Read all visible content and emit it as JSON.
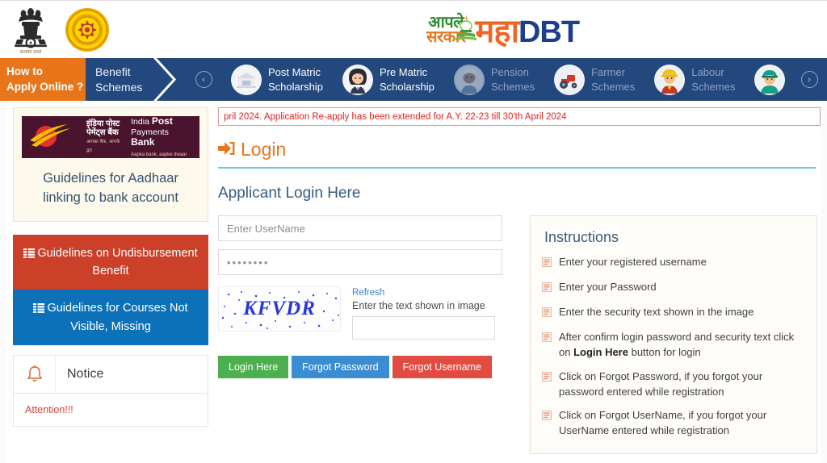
{
  "header": {
    "emblem_alt": "india-national-emblem",
    "emblem_caption": "सत्यमेव जयते",
    "seal_alt": "maharashtra-government-seal",
    "brand": {
      "aaple_line1": "आपले",
      "aaple_line2": "सरकार",
      "maha": "महा",
      "dbt": "DBT",
      "rupee": "₹"
    }
  },
  "nav": {
    "how_to_line1": "How to",
    "how_to_line2": "Apply Online ?",
    "benefit_line1": "Benefit",
    "benefit_line2": "Schemes",
    "prev_arrow": "‹",
    "next_arrow": "›",
    "items": [
      {
        "label_line1": "Post Matric",
        "label_line2": "Scholarship",
        "icon": "school-building-icon",
        "glyph": "🏫",
        "dim": false
      },
      {
        "label_line1": "Pre Matric",
        "label_line2": "Scholarship",
        "icon": "student-girl-icon",
        "glyph": "👩‍🎓",
        "dim": false
      },
      {
        "label_line1": "Pension",
        "label_line2": "Schemes",
        "icon": "elderly-person-icon",
        "glyph": "👴",
        "dim": true
      },
      {
        "label_line1": "Farmer",
        "label_line2": "Schemes",
        "icon": "tractor-icon",
        "glyph": "🚜",
        "dim": true
      },
      {
        "label_line1": "Labour",
        "label_line2": "Schemes",
        "icon": "construction-worker-icon",
        "glyph": "👷",
        "dim": true
      },
      {
        "label_line1": "",
        "label_line2": "",
        "icon": "police-officer-icon",
        "glyph": "👮",
        "dim": true
      }
    ]
  },
  "sidebar": {
    "ipbb": {
      "hindi_line1": "इंडिया पोस्ट",
      "hindi_line2": "पेमेंट्स बैंक",
      "hindi_tag": "आपका बैंक, आपके द्वार",
      "en_line1": "India Post",
      "en_line2": "Payments Bank",
      "en_tag": "Aapka bank, aapke dwaar",
      "caption_line1": "Guidelines for Aadhaar",
      "caption_line2": "linking to bank account"
    },
    "guideline_undisbursement": "Guidelines on Undisbursement Benefit",
    "guideline_courses": "Guidelines for Courses Not Visible, Missing",
    "notice_title": "Notice",
    "notice_bell_icon": "bell-icon",
    "notice_attention": "Attention!!!",
    "colors": {
      "undisbursement_bg": "#cc3f28",
      "courses_bg": "#0d71ba",
      "ipbb_bg": "#4a132e"
    }
  },
  "main": {
    "marquee": "pril 2024. Application Re-apply has been extended for A.Y. 22-23 till 30'th April 2024",
    "login_heading": "Login",
    "login_icon": "sign-in-arrow-icon",
    "applicant_heading": "Applicant Login Here",
    "username_placeholder": "Enter UserName",
    "password_value": "••••••••",
    "captcha_text": "KFVDR",
    "captcha_refresh": "Refresh",
    "captcha_label": "Enter the text shown in image",
    "captcha_input_value": "",
    "buttons": {
      "login": "Login Here",
      "forgot_password": "Forgot Password",
      "forgot_username": "Forgot Username"
    },
    "colors": {
      "login_btn": "#4cb050",
      "forgot_password_btn": "#3a8dd0",
      "forgot_username_btn": "#e14b42",
      "heading_orange": "#e8761b",
      "rule_blue": "#6fc6dd",
      "marquee_red": "#e02020"
    }
  },
  "instructions": {
    "title": "Instructions",
    "items": [
      {
        "text": "Enter your registered username"
      },
      {
        "text": "Enter your Password"
      },
      {
        "text": "Enter the security text shown in the image"
      },
      {
        "text_pre": "After confirm login password and security text click on ",
        "text_bold": "Login Here",
        "text_post": " button for login"
      },
      {
        "text": "Click on Forgot Password, if you forgot your password entered while registration"
      },
      {
        "text": "Click on Forgot UserName, if you forgot your UserName entered while registration"
      }
    ]
  }
}
